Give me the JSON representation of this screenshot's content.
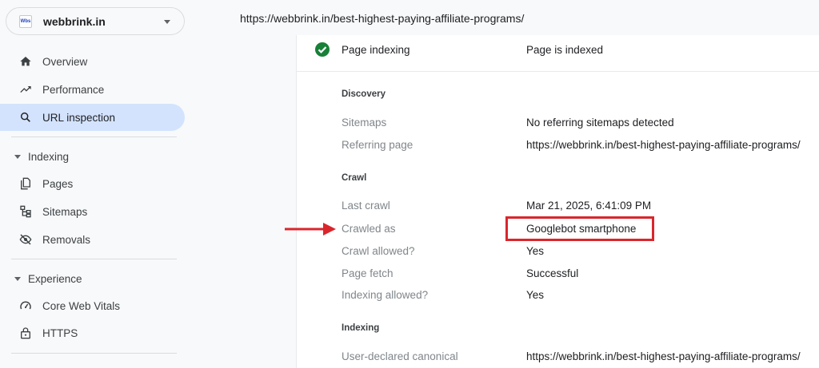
{
  "property": {
    "name": "webbrink.in",
    "favicon_text": "Wbs"
  },
  "sidebar": {
    "items": [
      {
        "label": "Overview",
        "icon": "home-icon"
      },
      {
        "label": "Performance",
        "icon": "trending-up-icon"
      },
      {
        "label": "URL inspection",
        "icon": "search-icon"
      }
    ],
    "indexing": {
      "title": "Indexing",
      "items": [
        {
          "label": "Pages",
          "icon": "pages-icon"
        },
        {
          "label": "Sitemaps",
          "icon": "sitemap-icon"
        },
        {
          "label": "Removals",
          "icon": "eye-off-icon"
        }
      ]
    },
    "experience": {
      "title": "Experience",
      "items": [
        {
          "label": "Core Web Vitals",
          "icon": "speedometer-icon"
        },
        {
          "label": "HTTPS",
          "icon": "lock-icon"
        }
      ]
    }
  },
  "url": "https://webbrink.in/best-highest-paying-affiliate-programs/",
  "inspection": {
    "status": {
      "label": "Page indexing",
      "value": "Page is indexed"
    },
    "discovery": {
      "title": "Discovery",
      "sitemaps": {
        "label": "Sitemaps",
        "value": "No referring sitemaps detected"
      },
      "referring": {
        "label": "Referring page",
        "value": "https://webbrink.in/best-highest-paying-affiliate-programs/"
      }
    },
    "crawl": {
      "title": "Crawl",
      "last_crawl": {
        "label": "Last crawl",
        "value": "Mar 21, 2025, 6:41:09 PM"
      },
      "crawled_as": {
        "label": "Crawled as",
        "value": "Googlebot smartphone"
      },
      "crawl_allowed": {
        "label": "Crawl allowed?",
        "value": "Yes"
      },
      "page_fetch": {
        "label": "Page fetch",
        "value": "Successful"
      },
      "indexing_allowed": {
        "label": "Indexing allowed?",
        "value": "Yes"
      }
    },
    "indexing": {
      "title": "Indexing",
      "canonical": {
        "label": "User-declared canonical",
        "value": "https://webbrink.in/best-highest-paying-affiliate-programs/"
      }
    }
  },
  "colors": {
    "accent": "#d3e3fd",
    "success": "#188038",
    "highlight": "#d9262c"
  }
}
